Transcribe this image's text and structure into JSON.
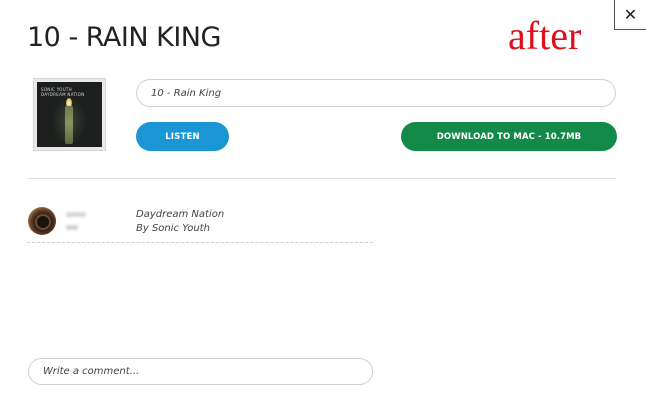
{
  "modal": {
    "close_label": "✕",
    "title": "10 - RAIN KING",
    "overlay_label": "after"
  },
  "album_cover": {
    "artist": "SONIC YOUTH",
    "album": "DAYDREAM NATION"
  },
  "track": {
    "value": "10 - Rain King"
  },
  "actions": {
    "listen_label": "LISTEN",
    "download_label": "DOWNLOAD TO MAC - 10.7MB",
    "listen_color": "#1a96d4",
    "download_color": "#138a48"
  },
  "comment_entry": {
    "album": "Daydream Nation",
    "artist": "By Sonic Youth"
  },
  "comment_input": {
    "placeholder": "Write a comment..."
  }
}
